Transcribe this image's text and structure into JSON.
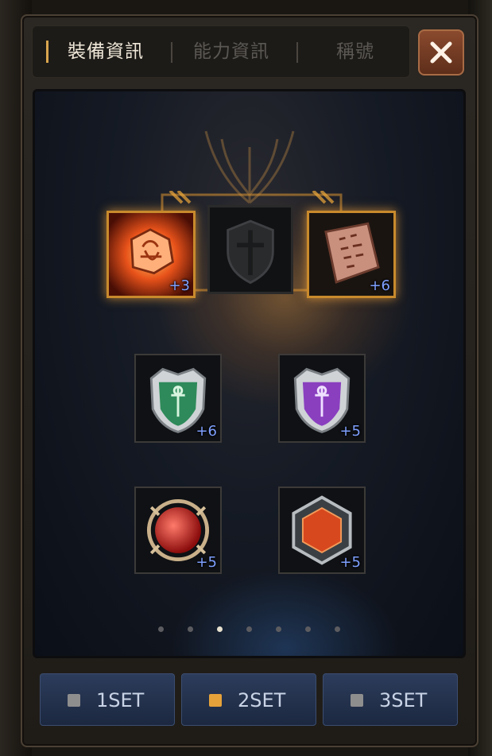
{
  "tabs": [
    {
      "label": "裝備資訊",
      "active": true
    },
    {
      "label": "能力資訊",
      "active": false
    },
    {
      "label": "稱號",
      "active": false
    }
  ],
  "close_icon": "close-x-icon",
  "equipment": {
    "top_row": [
      {
        "name": "fire-rune-item",
        "enhance": "+3",
        "frame": "gold"
      },
      {
        "name": "shield-cross-empty-slot",
        "enhance": "",
        "frame": "gold"
      },
      {
        "name": "rune-stone-item",
        "enhance": "+6",
        "frame": "gold"
      }
    ],
    "middle_row": [
      {
        "name": "green-emblem-item",
        "enhance": "+6"
      },
      {
        "name": "purple-emblem-item",
        "enhance": "+5"
      }
    ],
    "bottom_row": [
      {
        "name": "red-orb-item",
        "enhance": "+5"
      },
      {
        "name": "red-gem-item",
        "enhance": "+5"
      }
    ]
  },
  "pagination": {
    "total": 7,
    "active_index": 2
  },
  "sets": [
    {
      "label": "1SET",
      "selected": false
    },
    {
      "label": "2SET",
      "selected": true
    },
    {
      "label": "3SET",
      "selected": false
    }
  ],
  "colors": {
    "accent": "#d9a64e",
    "enhance": "#7fa0ff",
    "set_selected": "#e6a23a"
  }
}
